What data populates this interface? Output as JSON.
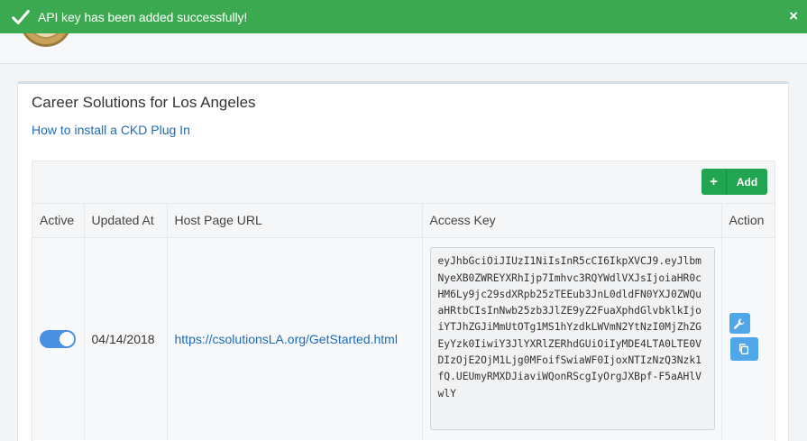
{
  "toast": {
    "message": "API key has been added successfully!",
    "close_label": "×",
    "color": "#3ba94f"
  },
  "card": {
    "title": "Career Solutions for Los Angeles",
    "help_link": "How to install a CKD Plug In"
  },
  "toolbar": {
    "add_icon": "+",
    "add_label": "Add"
  },
  "table": {
    "headers": {
      "active": "Active",
      "updated_at": "Updated At",
      "host_url": "Host Page URL",
      "access_key": "Access Key",
      "action": "Action"
    },
    "rows": [
      {
        "active": true,
        "updated_at": "04/14/2018",
        "host_url": "https://csolutionsLA.org/GetStarted.html",
        "access_key": "eyJhbGciOiJIUzI1NiIsInR5cCI6IkpXVCJ9.eyJlbmNyeXB0ZWREYXRhIjp7Imhvc3RQYWdlVXJsIjoiaHR0cHM6Ly9jc29sdXRpb25zTEEub3JnL0dldFN0YXJ0ZWQuaHRtbCIsInNwb25zb3JlZE9yZ2FuaXphdGlvbklkIjoiYTJhZGJiMmUtOTg1MS1hYzdkLWVmN2YtNzI0MjZhZGEyYzk0IiwiY3JlYXRlZERhdGUiOiIyMDE4LTA0LTE0VDIzOjE2OjM1Ljg0MFoifSwiaWF0IjoxNTIzNzQ3Nzk1fQ.UEUmyRMXDJiaviWQonRScgIyOrgJXBpf-F5aAHlVwlY"
      }
    ]
  },
  "icons": {
    "toast": "check-icon",
    "edit": "wrench-icon",
    "copy": "copy-icon"
  },
  "colors": {
    "accent": "#4a90e2",
    "success": "#21a550",
    "link": "#1e6bb8"
  }
}
